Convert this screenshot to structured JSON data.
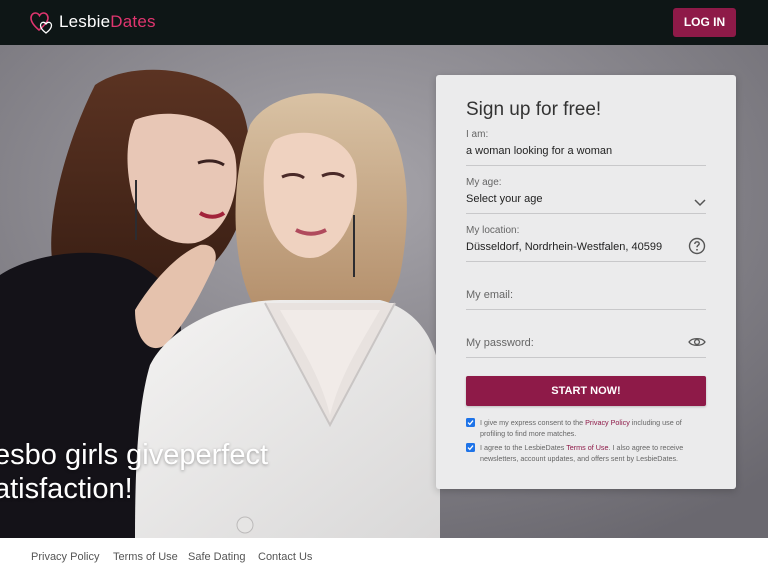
{
  "header": {
    "logo_part1": "Lesbie",
    "logo_part2": "Dates",
    "login_label": "LOG IN"
  },
  "hero": {
    "line1": "esbo girls giveperfect",
    "line2": "atisfaction!"
  },
  "signup": {
    "title": "Sign up for free!",
    "iam_label": "I am:",
    "iam_value": "a woman looking for a woman",
    "age_label": "My age:",
    "age_value": "Select your age",
    "location_label": "My location:",
    "location_value": "Düsseldorf, Nordrhein-Westfalen, 40599",
    "email_placeholder": "My email:",
    "password_placeholder": "My password:",
    "start_label": "START NOW!",
    "consent1_pre": "I give my express consent to the ",
    "consent1_link": "Privacy Policy",
    "consent1_post": " including use of profiling to find more matches.",
    "consent2_pre": "I agree to the LesbieDates ",
    "consent2_link": "Terms of Use",
    "consent2_post": ". I also agree to receive newsletters, account updates, and offers sent by LesbieDates."
  },
  "footer": {
    "links": [
      "Privacy Policy",
      "Terms of Use",
      "Safe Dating",
      "Contact Us"
    ]
  },
  "colors": {
    "brand": "#8e1a48",
    "topbar": "#0e1616",
    "logo_accent": "#e0356f",
    "checkbox": "#1e73e8"
  },
  "icons": [
    "hearts-logo-icon",
    "chevron-down-icon",
    "question-circle-icon",
    "eye-icon",
    "checkmark-icon"
  ]
}
